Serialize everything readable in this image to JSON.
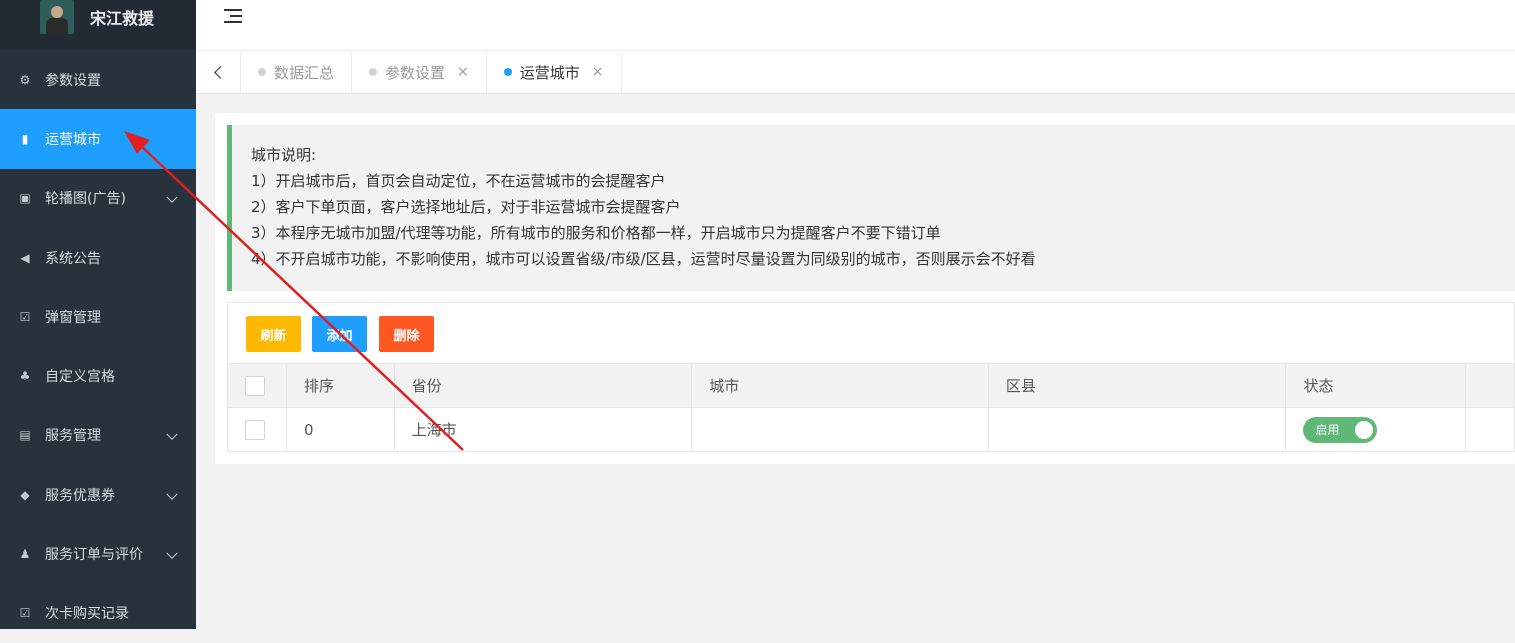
{
  "brand": {
    "name": "宋江救援"
  },
  "sidebar": {
    "items": [
      {
        "label": "参数设置",
        "icon": "gear-icon",
        "glyph": "⚙",
        "active": false,
        "expandable": false
      },
      {
        "label": "运营城市",
        "icon": "building-icon",
        "glyph": "▮",
        "active": true,
        "expandable": false
      },
      {
        "label": "轮播图(广告)",
        "icon": "image-icon",
        "glyph": "▣",
        "active": false,
        "expandable": true
      },
      {
        "label": "系统公告",
        "icon": "speaker-icon",
        "glyph": "◀",
        "active": false,
        "expandable": false
      },
      {
        "label": "弹窗管理",
        "icon": "check-square-icon",
        "glyph": "☑",
        "active": false,
        "expandable": false
      },
      {
        "label": "自定义宫格",
        "icon": "sitemap-icon",
        "glyph": "♣",
        "active": false,
        "expandable": false
      },
      {
        "label": "服务管理",
        "icon": "server-icon",
        "glyph": "▤",
        "active": false,
        "expandable": true
      },
      {
        "label": "服务优惠券",
        "icon": "ticket-icon",
        "glyph": "◆",
        "active": false,
        "expandable": true
      },
      {
        "label": "服务订单与评价",
        "icon": "stamp-icon",
        "glyph": "♟",
        "active": false,
        "expandable": true
      },
      {
        "label": "次卡购买记录",
        "icon": "check-square-icon",
        "glyph": "☑",
        "active": false,
        "expandable": false
      }
    ]
  },
  "tabs": [
    {
      "label": "数据汇总",
      "active": false,
      "closable": false
    },
    {
      "label": "参数设置",
      "active": false,
      "closable": true
    },
    {
      "label": "运营城市",
      "active": true,
      "closable": true
    }
  ],
  "notice": {
    "title": "城市说明:",
    "lines": [
      "1）开启城市后，首页会自动定位，不在运营城市的会提醒客户",
      "2）客户下单页面，客户选择地址后，对于非运营城市会提醒客户",
      "3）本程序无城市加盟/代理等功能，所有城市的服务和价格都一样，开启城市只为提醒客户不要下错订单",
      "4）不开启城市功能，不影响使用，城市可以设置省级/市级/区县，运营时尽量设置为同级别的城市，否则展示会不好看"
    ]
  },
  "toolbar": {
    "refresh_label": "刷新",
    "add_label": "添加",
    "delete_label": "删除"
  },
  "table": {
    "headers": [
      "排序",
      "省份",
      "城市",
      "区县",
      "状态"
    ],
    "rows": [
      {
        "sort": "0",
        "province": "上海市",
        "city": "",
        "district": "",
        "status": "启用"
      }
    ]
  },
  "colors": {
    "accent": "#1e9fff",
    "success": "#5fb878",
    "warning": "#ffb800",
    "danger": "#ff5722",
    "annotation": "#e02020"
  }
}
